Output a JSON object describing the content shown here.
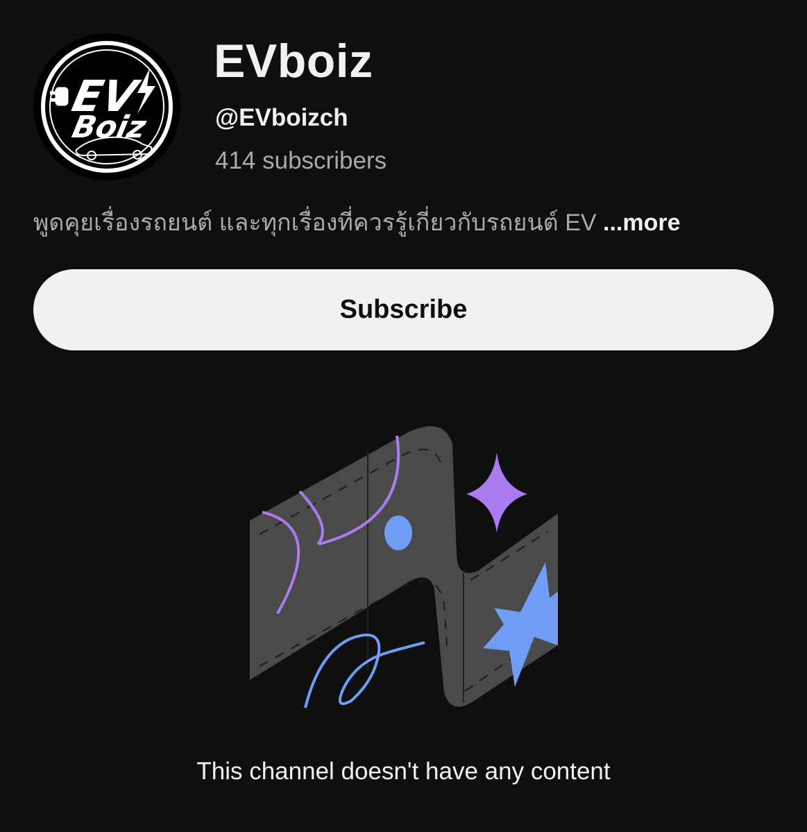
{
  "channel": {
    "name": "EVboiz",
    "handle": "@EVboizch",
    "subscribers": "414 subscribers",
    "description": "พูดคุยเรื่องรถยนต์ และทุกเรื่องที่ควรรู้เกี่ยวกับรถยนต์ EV",
    "more_label": "...more",
    "avatar_logo_text": [
      "EV",
      "Boiz"
    ]
  },
  "subscribe_button": {
    "label": "Subscribe"
  },
  "empty_state": {
    "message": "This channel doesn't have any content",
    "illustration": "empty-channel-illustration"
  },
  "colors": {
    "background": "#0f0f0f",
    "primary_text": "#f1f1f1",
    "secondary_text": "#aaaaaa",
    "button_bg": "#f1f1f1",
    "illustration_band": "#4a4a4a",
    "accent_purple": "#a97cf0",
    "accent_blue": "#6f9cf5"
  }
}
